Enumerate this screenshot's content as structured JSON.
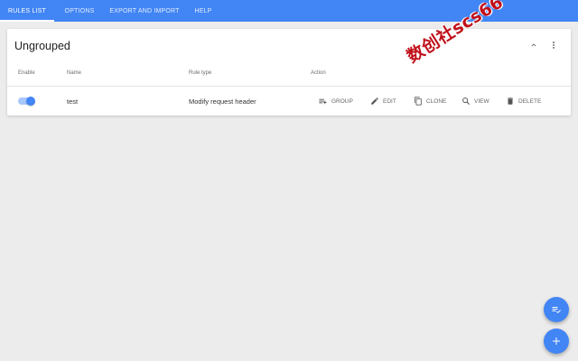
{
  "tabs": [
    {
      "label": "Rules List"
    },
    {
      "label": "Options"
    },
    {
      "label": "Export and Import"
    },
    {
      "label": "Help"
    }
  ],
  "group": {
    "title": "Ungrouped",
    "columns": {
      "enable": "Enable",
      "name": "Name",
      "rule_type": "Rule type",
      "action": "Action"
    },
    "rules": [
      {
        "enabled": true,
        "name": "test",
        "rule_type": "Modify request header"
      }
    ],
    "actions": {
      "group": "Group",
      "edit": "Edit",
      "clone": "Clone",
      "view": "View",
      "delete": "Delete"
    }
  },
  "watermark": "数创社scs66",
  "colors": {
    "primary": "#4285f4",
    "background": "#ececec",
    "toggle_track": "#a8c7fa",
    "watermark": "#c0101a"
  },
  "icons": {
    "collapse": "chevron-up-icon",
    "more": "more-vert-icon",
    "group": "playlist-add-icon",
    "edit": "pencil-icon",
    "clone": "copy-icon",
    "view": "search-icon",
    "delete": "trash-icon",
    "fab_groups": "playlist-check-icon",
    "fab_add": "plus-icon"
  }
}
